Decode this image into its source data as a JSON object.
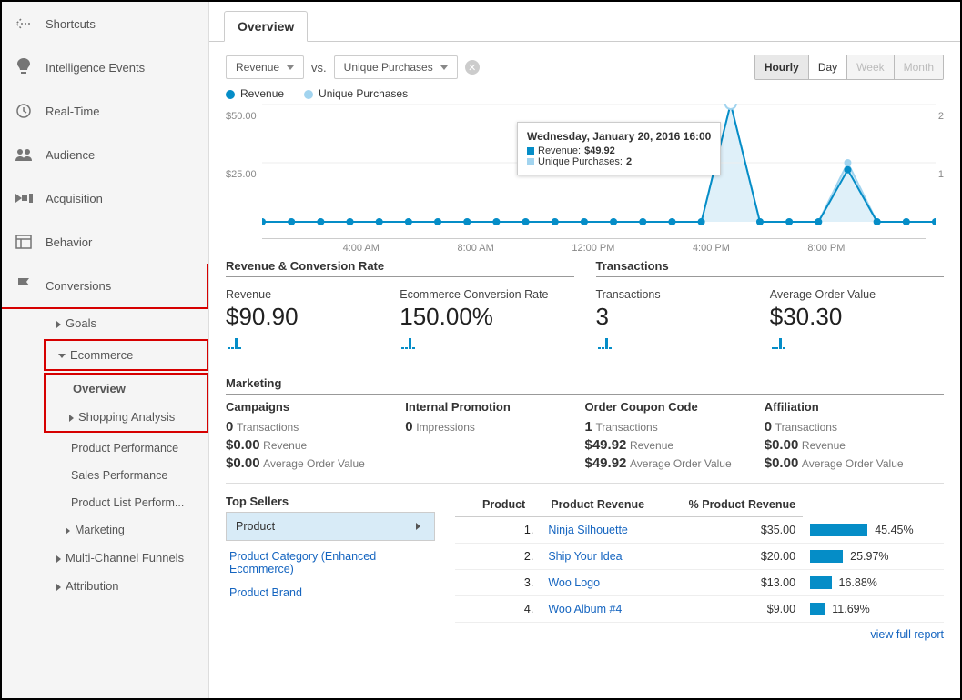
{
  "sidebar": {
    "shortcuts": "Shortcuts",
    "intelligence": "Intelligence Events",
    "realtime": "Real-Time",
    "audience": "Audience",
    "acquisition": "Acquisition",
    "behavior": "Behavior",
    "conversions": "Conversions",
    "goals": "Goals",
    "ecommerce": "Ecommerce",
    "overview": "Overview",
    "shopping": "Shopping Analysis",
    "product_perf": "Product Performance",
    "sales_perf": "Sales Performance",
    "product_list": "Product List Perform...",
    "mk": "Marketing",
    "multi": "Multi-Channel Funnels",
    "attribution": "Attribution"
  },
  "tab": "Overview",
  "selectors": {
    "metric1": "Revenue",
    "vs": "vs.",
    "metric2": "Unique Purchases"
  },
  "time_toggle": {
    "hourly": "Hourly",
    "day": "Day",
    "week": "Week",
    "month": "Month"
  },
  "legend": {
    "a": "Revenue",
    "b": "Unique Purchases"
  },
  "chart_data": {
    "type": "line",
    "x": [
      "12:00 AM",
      "1:00 AM",
      "2:00 AM",
      "3:00 AM",
      "4:00 AM",
      "5:00 AM",
      "6:00 AM",
      "7:00 AM",
      "8:00 AM",
      "9:00 AM",
      "10:00 AM",
      "11:00 AM",
      "12:00 PM",
      "1:00 PM",
      "2:00 PM",
      "3:00 PM",
      "4:00 PM",
      "5:00 PM",
      "6:00 PM",
      "7:00 PM",
      "8:00 PM",
      "9:00 PM",
      "10:00 PM",
      "11:00 PM"
    ],
    "x_ticks": [
      "4:00 AM",
      "8:00 AM",
      "12:00 PM",
      "4:00 PM",
      "8:00 PM"
    ],
    "series": [
      {
        "name": "Revenue",
        "color": "#058dc7",
        "ylim": [
          0,
          50
        ],
        "y_ticks": [
          "$25.00",
          "$50.00"
        ],
        "values": [
          0,
          0,
          0,
          0,
          0,
          0,
          0,
          0,
          0,
          0,
          0,
          0,
          0,
          0,
          0,
          0,
          49.92,
          0,
          0,
          0,
          22,
          0,
          0,
          0
        ]
      },
      {
        "name": "Unique Purchases",
        "color": "#a2d4ef",
        "ylim": [
          0,
          2
        ],
        "y_ticks": [
          "1",
          "2"
        ],
        "values": [
          0,
          0,
          0,
          0,
          0,
          0,
          0,
          0,
          0,
          0,
          0,
          0,
          0,
          0,
          0,
          0,
          2,
          0,
          0,
          0,
          1,
          0,
          0,
          0
        ]
      }
    ],
    "tooltip": {
      "title": "Wednesday, January 20, 2016 16:00",
      "rev_label": "Revenue:",
      "rev_val": "$49.92",
      "up_label": "Unique Purchases:",
      "up_val": "2"
    }
  },
  "sections": {
    "rev_conv": "Revenue & Conversion Rate",
    "transactions": "Transactions"
  },
  "metrics": {
    "revenue_l": "Revenue",
    "revenue_v": "$90.90",
    "ecr_l": "Ecommerce Conversion Rate",
    "ecr_v": "150.00%",
    "tx_l": "Transactions",
    "tx_v": "3",
    "aov_l": "Average Order Value",
    "aov_v": "$30.30"
  },
  "marketing": {
    "title": "Marketing",
    "cols": [
      {
        "head": "Campaigns",
        "v1": "0",
        "u1": "Transactions",
        "v2": "$0.00",
        "u2": "Revenue",
        "v3": "$0.00",
        "u3": "Average Order Value"
      },
      {
        "head": "Internal Promotion",
        "v1": "0",
        "u1": "Impressions",
        "v2": "",
        "u2": "",
        "v3": "",
        "u3": ""
      },
      {
        "head": "Order Coupon Code",
        "v1": "1",
        "u1": "Transactions",
        "v2": "$49.92",
        "u2": "Revenue",
        "v3": "$49.92",
        "u3": "Average Order Value"
      },
      {
        "head": "Affiliation",
        "v1": "0",
        "u1": "Transactions",
        "v2": "$0.00",
        "u2": "Revenue",
        "v3": "$0.00",
        "u3": "Average Order Value"
      }
    ]
  },
  "top_sellers": {
    "title": "Top Sellers",
    "product_dim": "Product",
    "cat_link": "Product Category (Enhanced Ecommerce)",
    "brand_link": "Product Brand",
    "th_product": "Product",
    "th_rev": "Product Revenue",
    "th_pct": "% Product Revenue",
    "rows": [
      {
        "idx": "1.",
        "name": "Ninja Silhouette",
        "rev": "$35.00",
        "pct": "45.45%",
        "bar": 45.45
      },
      {
        "idx": "2.",
        "name": "Ship Your Idea",
        "rev": "$20.00",
        "pct": "25.97%",
        "bar": 25.97
      },
      {
        "idx": "3.",
        "name": "Woo Logo",
        "rev": "$13.00",
        "pct": "16.88%",
        "bar": 16.88
      },
      {
        "idx": "4.",
        "name": "Woo Album #4",
        "rev": "$9.00",
        "pct": "11.69%",
        "bar": 11.69
      }
    ]
  },
  "full_report": "view full report"
}
